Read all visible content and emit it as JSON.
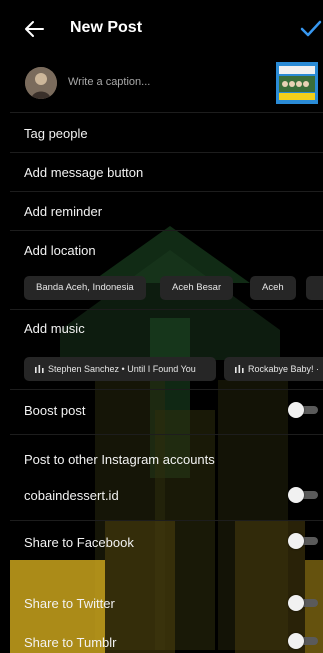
{
  "header": {
    "title": "New Post"
  },
  "caption": {
    "placeholder": "Write a caption..."
  },
  "menu": {
    "tag_people": "Tag people",
    "add_message_button": "Add message button",
    "add_reminder": "Add reminder",
    "add_location": "Add location",
    "add_music": "Add music"
  },
  "location_suggestions": [
    "Banda Aceh, Indonesia",
    "Aceh Besar",
    "Aceh"
  ],
  "music_suggestions": [
    "Stephen Sanchez • Until I Found You",
    "Rockabye Baby! ·"
  ],
  "boost_post": {
    "label": "Boost post",
    "enabled": false
  },
  "other_accounts": {
    "heading": "Post to other Instagram accounts",
    "account": {
      "name": "cobaindessert.id",
      "enabled": false
    }
  },
  "share": {
    "facebook": {
      "label": "Share to Facebook",
      "enabled": false
    },
    "twitter": {
      "label": "Share to Twitter",
      "enabled": false
    },
    "tumblr": {
      "label": "Share to Tumblr",
      "enabled": false
    }
  },
  "colors": {
    "background": "#000000",
    "accent": "#3797f0",
    "chip": "#262626",
    "watermark_green": "#1f4f27",
    "watermark_yellow": "#c9a31c"
  },
  "icons": {
    "back": "arrow-left-icon",
    "confirm": "checkmark-icon",
    "music": "equalizer-icon"
  }
}
